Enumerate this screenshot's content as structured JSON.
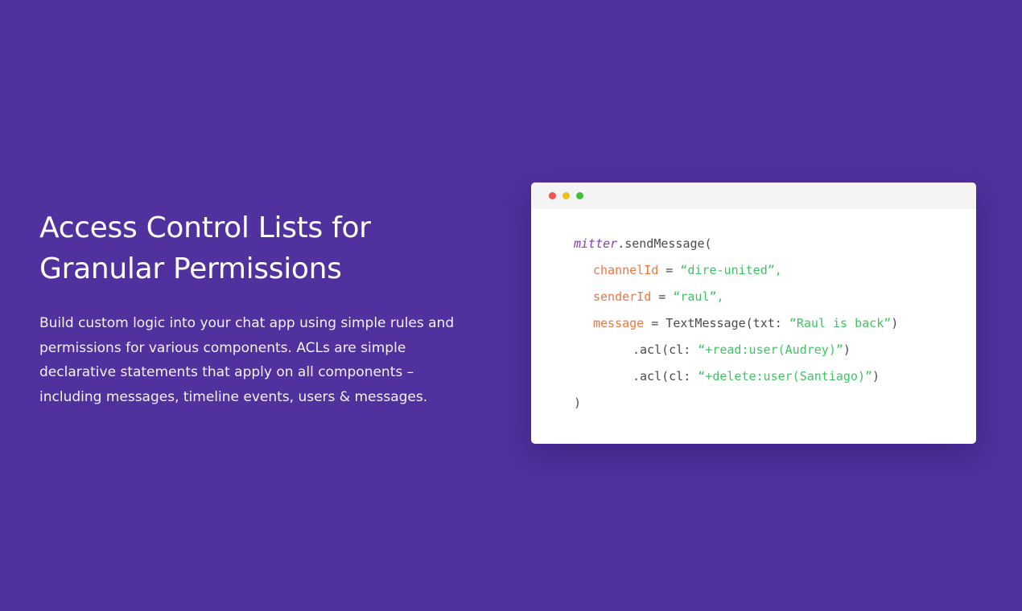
{
  "section": {
    "title_line1": "Access Control Lists for",
    "title_line2": "Granular Permissions",
    "description_lines": [
      "Build custom logic into your chat app using simple rules and",
      "permissions for various components. ACLs are simple",
      "declarative statements that apply on all components –",
      "including messages, timeline events, users & messages."
    ]
  },
  "colors": {
    "background": "#51319d",
    "window": "#ffffff",
    "title_bar": "#f4f4f4",
    "dot_red": "#f35454",
    "dot_yellow": "#e9c31a",
    "dot_green": "#3fc23b",
    "code_object": "#8a3bb5",
    "code_key": "#f0743f",
    "code_string": "#3fc463",
    "code_plain": "#4a4a4a"
  },
  "code_window": {
    "line1": {
      "object": "mitter",
      "rest": ".sendMessage("
    },
    "line2": {
      "key": "channelId",
      "op": " = ",
      "value": "“dire-united”,"
    },
    "line3": {
      "key": "senderId",
      "op": " = ",
      "value": "“raul”,"
    },
    "line4": {
      "key": "message",
      "op": " = TextMessage(txt: ",
      "value": "“Raul is back”",
      "close": ")"
    },
    "line5": {
      "prefix": ".acl(cl: ",
      "value": "“+read:user(Audrey)”",
      "close": ")"
    },
    "line6": {
      "prefix": ".acl(cl: ",
      "value": "“+delete:user(Santiago)”",
      "close": ")"
    },
    "line7": {
      "text": ")"
    }
  }
}
